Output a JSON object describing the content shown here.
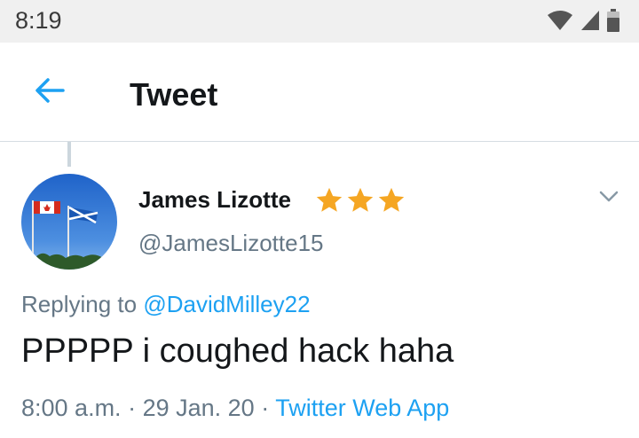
{
  "status_bar": {
    "time": "8:19",
    "icons": [
      "wifi-icon",
      "cell-signal-icon",
      "battery-icon"
    ]
  },
  "header": {
    "title": "Tweet",
    "back_icon": "back-arrow-icon"
  },
  "tweet": {
    "author": {
      "name": "James Lizotte",
      "handle": "@JamesLizotte15",
      "badge_emoji": [
        "star-icon",
        "star-icon",
        "star-icon"
      ]
    },
    "reply_to": {
      "prefix": "Replying to",
      "handle": "@DavidMilley22"
    },
    "text": "PPPPP i coughed hack haha",
    "meta": {
      "time": "8:00 a.m.",
      "separator": "·",
      "date": "29 Jan. 20",
      "source": "Twitter Web App"
    },
    "menu_icon": "chevron-down-icon"
  },
  "colors": {
    "accent": "#1da1f2",
    "secondary_text": "#657786",
    "primary_text": "#14171a",
    "star": "#f5a623"
  }
}
